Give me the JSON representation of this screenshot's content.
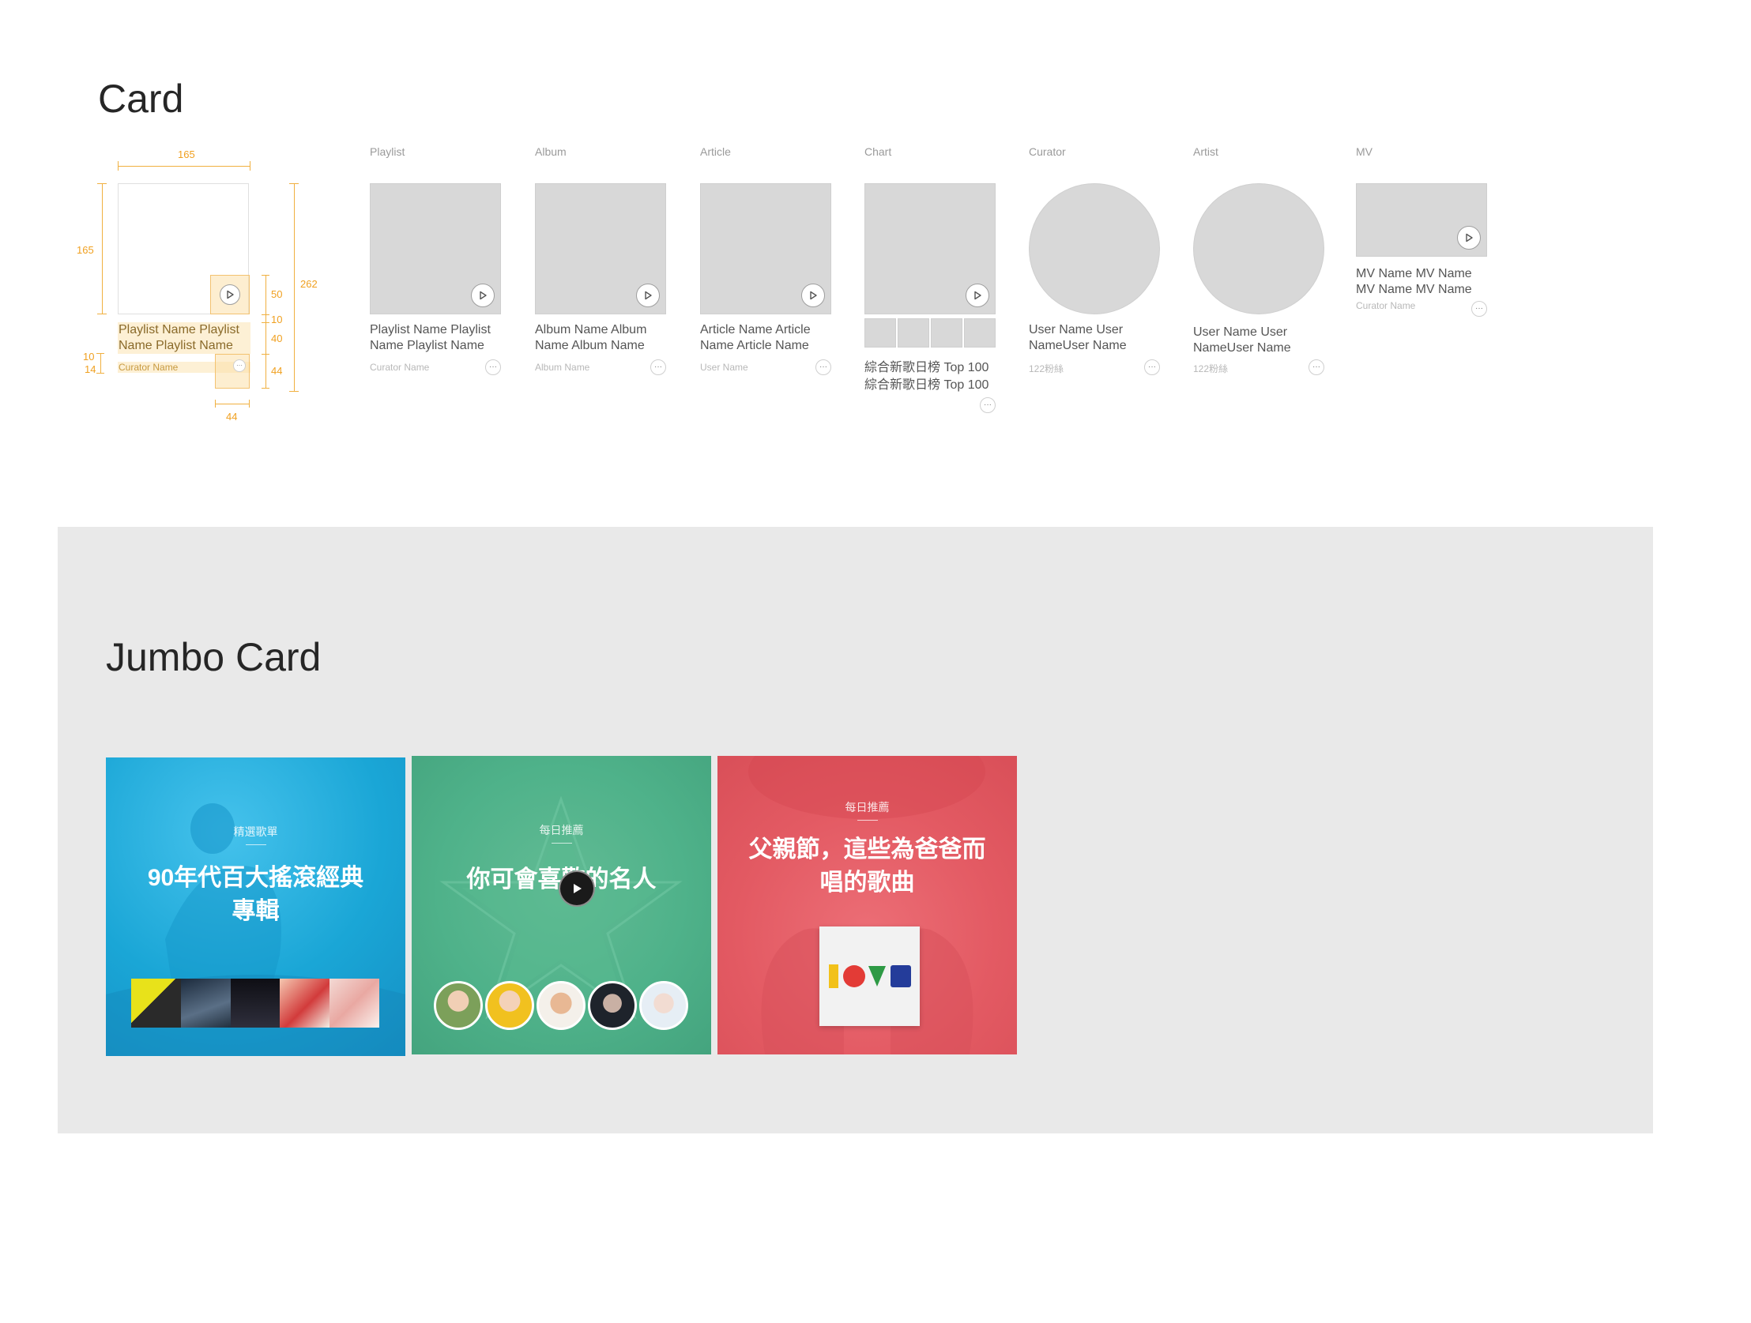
{
  "card_section": {
    "title": "Card",
    "spec": {
      "width": "165",
      "height": "165",
      "total": "262",
      "gap_10": "10",
      "line_14": "14",
      "play_area": "50",
      "gap_10b": "10",
      "title_area": "40",
      "more_area": "44",
      "more_width": "44",
      "sample_title": "Playlist Name Playlist Name Playlist Name",
      "sample_sub": "Curator Name",
      "more_glyph": "···"
    },
    "cards": [
      {
        "label": "Playlist",
        "title": "Playlist Name Playlist Name Playlist  Name",
        "sub": "Curator Name",
        "more": "···"
      },
      {
        "label": "Album",
        "title": "Album Name Album Name Album Name",
        "sub": "Album Name",
        "more": "···"
      },
      {
        "label": "Article",
        "title": "Article Name Article Name Article Name",
        "sub": "User Name",
        "more": "···"
      },
      {
        "label": "Chart",
        "title": "綜合新歌日榜 Top 100 綜合新歌日榜 Top 100",
        "sub": "",
        "more": "···"
      },
      {
        "label": "Curator",
        "title": "User Name User NameUser Name",
        "sub": "122粉絲",
        "more": "···"
      },
      {
        "label": "Artist",
        "title": "User Name User NameUser Name",
        "sub": "122粉絲",
        "more": "···"
      },
      {
        "label": "MV",
        "title": "MV Name MV Name MV Name MV Name",
        "sub": "Curator Name",
        "more": "···"
      }
    ]
  },
  "jumbo_section": {
    "title": "Jumbo Card",
    "cards": [
      {
        "tag": "精選歌單",
        "title": "90年代百大搖滾經典專輯",
        "color": "#1aa6d6"
      },
      {
        "tag": "每日推薦",
        "title": "你可會喜歡的名人",
        "color": "#4fb28a"
      },
      {
        "tag": "每日推薦",
        "title": "父親節，這些為爸爸而唱的歌曲",
        "color": "#e35a63"
      }
    ]
  }
}
